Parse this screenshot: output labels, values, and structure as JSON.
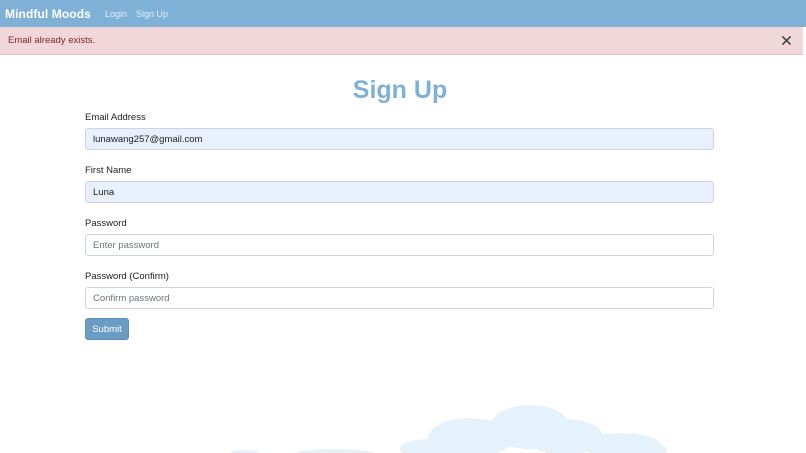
{
  "navbar": {
    "brand": "Mindful Moods",
    "links": [
      "Login",
      "Sign Up"
    ]
  },
  "alert": {
    "message": "Email already exists.",
    "close_icon": "close-icon"
  },
  "form": {
    "title": "Sign Up",
    "fields": [
      {
        "label": "Email Address",
        "value": "lunawang257@gmail.com",
        "placeholder": ""
      },
      {
        "label": "First Name",
        "value": "Luna",
        "placeholder": ""
      },
      {
        "label": "Password",
        "value": "",
        "placeholder": "Enter password"
      },
      {
        "label": "Password (Confirm)",
        "value": "",
        "placeholder": "Confirm password"
      }
    ],
    "submit_label": "Submit"
  },
  "colors": {
    "brand": "#7fb0d6",
    "alert_background": "#f2d7da",
    "alert_text": "#7a2730",
    "autofill_background": "#e8f0fe",
    "submit_button": "#6b9cc4"
  },
  "decoration": {
    "background_icon": "cloud-icon"
  }
}
